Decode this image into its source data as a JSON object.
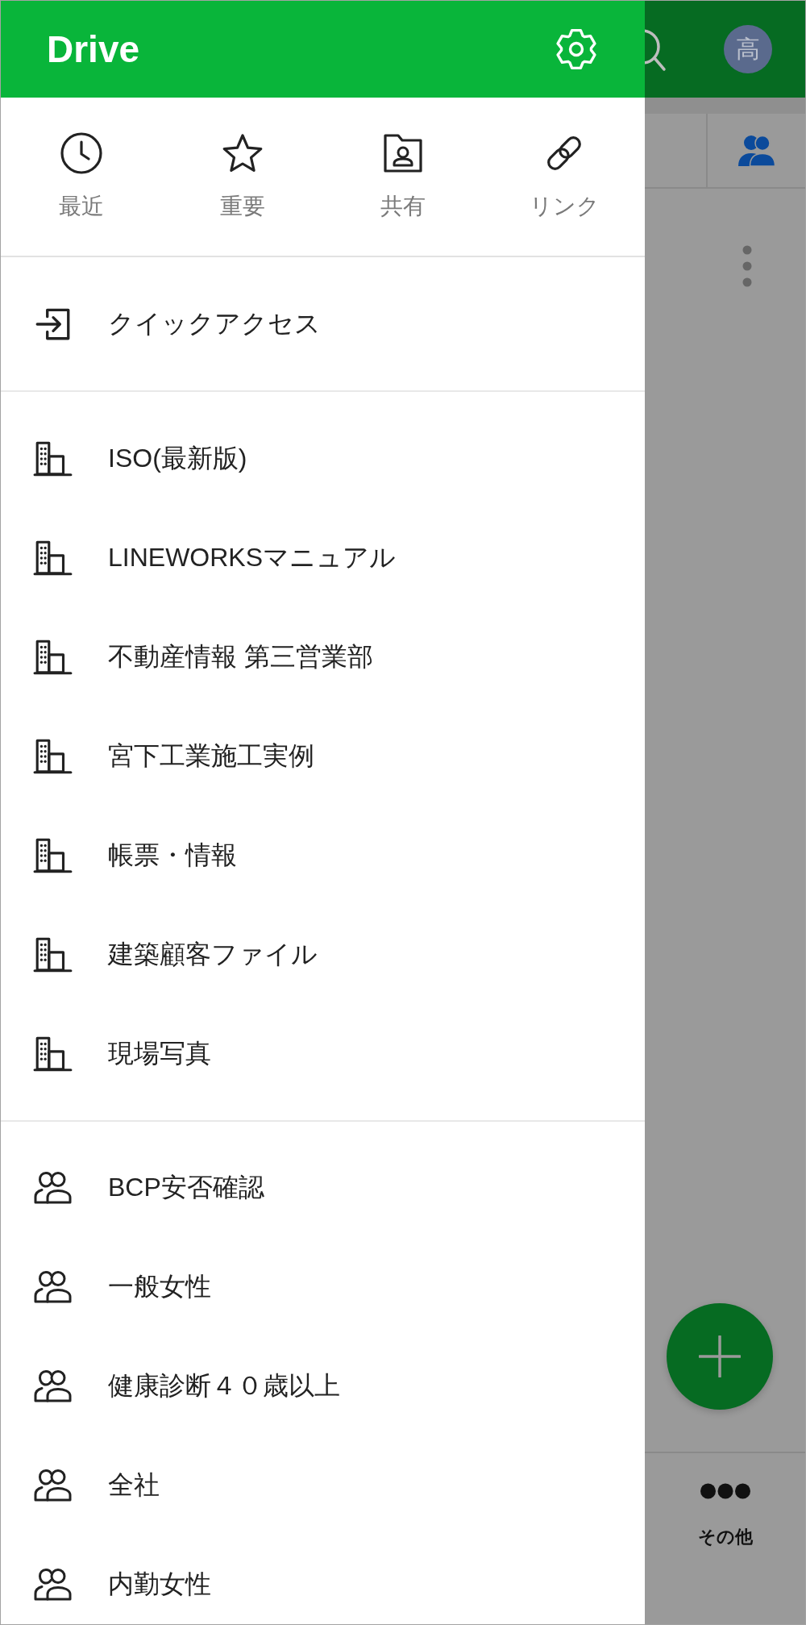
{
  "drawer": {
    "title": "Drive",
    "quick_links": [
      {
        "kind": "recent",
        "label": "最近"
      },
      {
        "kind": "starred",
        "label": "重要"
      },
      {
        "kind": "shared",
        "label": "共有"
      },
      {
        "kind": "link",
        "label": "リンク"
      }
    ],
    "quick_access": {
      "label": "クイックアクセス"
    },
    "company_folders": [
      "ISO(最新版)",
      "LINEWORKSマニュアル",
      "不動産情報 第三営業部",
      "宮下工業施工実例",
      "帳票・情報",
      "建築顧客ファイル",
      "現場写真"
    ],
    "group_folders": [
      "BCP安否確認",
      "一般女性",
      "健康診断４０歳以上",
      "全社",
      "内勤女性"
    ]
  },
  "background": {
    "avatar": "高",
    "bottom_tab": {
      "label": "その他"
    }
  }
}
